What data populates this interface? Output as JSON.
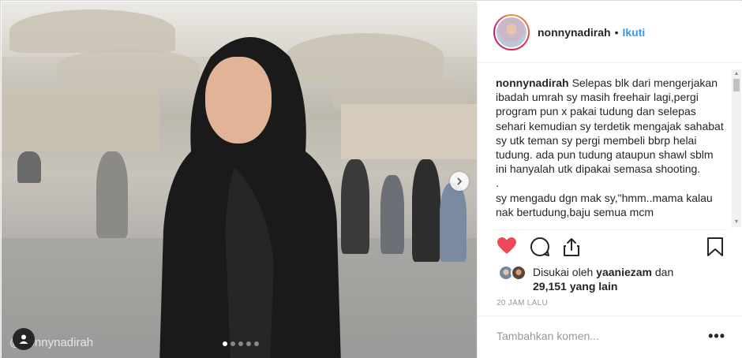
{
  "post": {
    "watermark": "@nonnynadirah",
    "carousel": {
      "total": 5,
      "active": 1
    }
  },
  "header": {
    "username": "nonnynadirah",
    "separator": "•",
    "follow_label": "Ikuti"
  },
  "caption": {
    "username": "nonnynadirah",
    "text": "Selepas blk dari mengerjakan ibadah umrah sy masih freehair lagi,pergi program pun x pakai tudung dan selepas sehari kemudian sy terdetik mengajak sahabat sy utk teman sy pergi membeli bbrp helai tudung. ada pun tudung ataupun shawl sblm ini hanyalah utk dipakai semasa shooting.\n.\nsy mengadu dgn mak sy,\"hmm..mama kalau nak bertudung,baju semua mcm"
  },
  "likes": {
    "prefix": "Disukai oleh",
    "user": "yaaniezam",
    "conjunction": "dan",
    "count_text": "29,151 yang lain"
  },
  "timestamp": "20 JAM LALU",
  "comment": {
    "placeholder": "Tambahkan komen...",
    "more_label": "•••"
  },
  "colors": {
    "accent": "#3897f0",
    "like_red": "#ed4956",
    "text": "#262626",
    "muted": "#999999",
    "border": "#efefef"
  },
  "icons": [
    "user-tag-icon",
    "next-arrow-icon",
    "heart-icon",
    "comment-icon",
    "share-icon",
    "bookmark-icon"
  ]
}
